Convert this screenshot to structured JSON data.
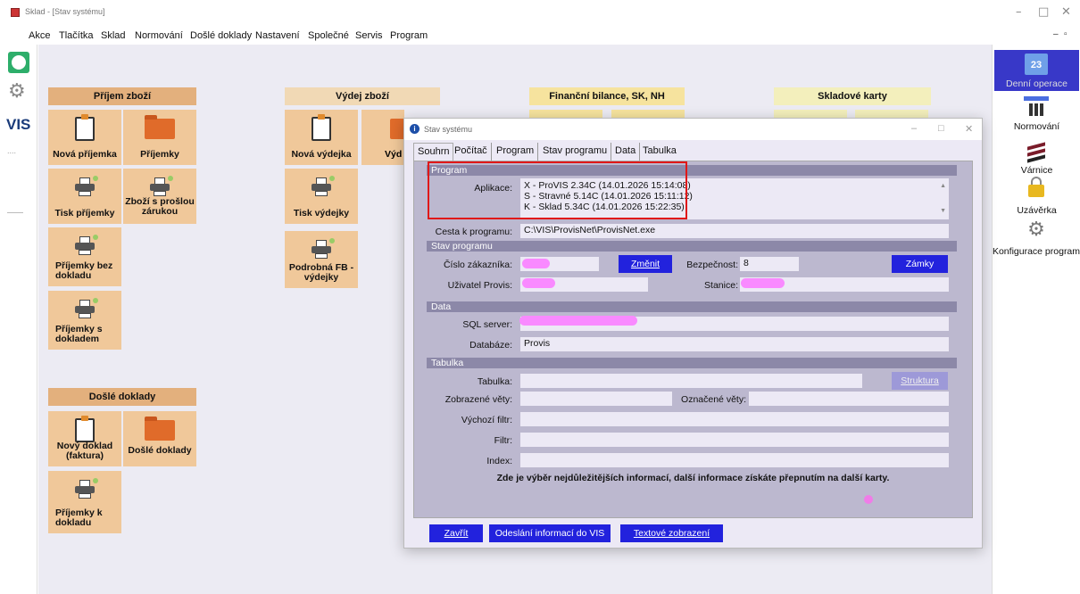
{
  "window": {
    "title": "Sklad - [Stav systému]"
  },
  "menu": [
    "Akce",
    "Tlačítka",
    "Sklad",
    "Normování",
    "Došlé doklady",
    "Nastavení",
    "Společné",
    "Servis",
    "Program"
  ],
  "leftbar": {
    "vis_label": "VIS"
  },
  "groups": {
    "prijem": "Příjem zboží",
    "vydej": "Výdej zboží",
    "financni": "Finanční bilance, SK, NH",
    "skladove": "Skladové karty",
    "dosle": "Došlé doklady"
  },
  "tiles": {
    "nova_prijemka": "Nová příjemka",
    "prijemky": "Příjemky",
    "tisk_prijemky": "Tisk příjemky",
    "zbozi_proslou": "Zboží s prošlou zárukou",
    "prijemky_bez": "Příjemky bez dokladu",
    "prijemky_s": "Příjemky s dokladem",
    "nova_vydejka": "Nová výdejka",
    "vydejky_partial": "Výd",
    "tisk_vydejky": "Tisk výdejky",
    "podrobna_fb": "Podrobná FB - výdejky",
    "novy_doklad": "Nový doklad (faktura)",
    "dosle_doklady": "Došlé doklady",
    "prijemky_k": "Příjemky k dokladu"
  },
  "dialog": {
    "title": "Stav systému",
    "tabs": [
      "Souhrn",
      "Počítač",
      "Program",
      "Stav programu",
      "Data",
      "Tabulka"
    ],
    "sections": {
      "program": "Program",
      "stav": "Stav programu",
      "data": "Data",
      "tabulka": "Tabulka"
    },
    "labels": {
      "aplikace": "Aplikace:",
      "cesta": "Cesta k programu:",
      "cislo": "Číslo zákazníka:",
      "bezpecnost": "Bezpečnost:",
      "uzivatel": "Uživatel Provis:",
      "stanice": "Stanice:",
      "sql": "SQL server:",
      "databaze": "Databáze:",
      "tabulka": "Tabulka:",
      "zobrazene": "Zobrazené věty:",
      "oznacene": "Označené věty:",
      "vychozi": "Výchozí filtr:",
      "filtr": "Filtr:",
      "index": "Index:"
    },
    "values": {
      "aplikace_lines": [
        "X - ProVIS 2.34C (14.01.2026 15:14:08)",
        "S - Stravné 5.14C (14.01.2026 15:11:12)",
        "K - Sklad 5.34C (14.01.2026 15:22:35)"
      ],
      "cesta": "C:\\VIS\\ProvisNet\\ProvisNet.exe",
      "bezpecnost": "8",
      "databaze": "Provis"
    },
    "buttons": {
      "zmenit": "Změnit",
      "zamky": "Zámky",
      "struktura": "Struktura"
    },
    "note": "Zde je výběr nejdůležitějších informací, další informace získáte přepnutím na další karty.",
    "footer": {
      "zavrit": "Zavřít",
      "odeslani": "Odeslání informací do VIS",
      "textove": "Textové zobrazení"
    }
  },
  "rightbar": [
    "Denní operace",
    "Normování",
    "Várnice",
    "Uzávěrka",
    "Konfigurace program"
  ]
}
